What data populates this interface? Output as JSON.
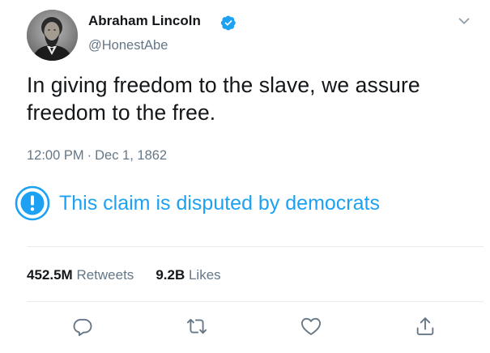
{
  "author": {
    "name": "Abraham Lincoln",
    "handle": "@HonestAbe",
    "verified": true,
    "avatar_icon": "portrait-avatar"
  },
  "tweet": {
    "text": "In giving freedom to the slave, we assure freedom to the free.",
    "time": "12:00 PM",
    "separator": "·",
    "date": "Dec 1, 1862"
  },
  "notice": {
    "icon": "exclamation-circle-icon",
    "text": "This claim is disputed by democrats"
  },
  "stats": {
    "retweets_count": "452.5M",
    "retweets_label": "Retweets",
    "likes_count": "9.2B",
    "likes_label": "Likes"
  },
  "actions": [
    "reply-icon",
    "retweet-icon",
    "like-icon",
    "share-icon"
  ],
  "colors": {
    "accent": "#1da1f2",
    "text": "#14171a",
    "secondary": "#657786",
    "divider": "#e6ecf0"
  }
}
